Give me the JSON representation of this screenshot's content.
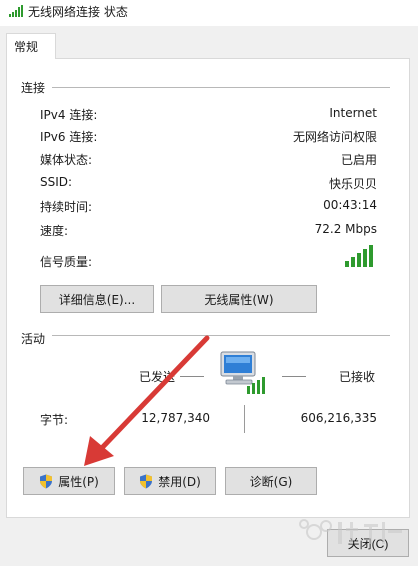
{
  "colors": {
    "panel_background": "#ffffff",
    "dialog_background": "#f0f0f0",
    "signal_green": "#2e9a2e",
    "arrow_red": "#d83a36"
  },
  "window": {
    "title": "无线网络连接 状态",
    "title_icon": "wifi-signal-icon"
  },
  "tabs": [
    {
      "label": "常规",
      "selected": true
    }
  ],
  "connection": {
    "group_title": "连接",
    "rows": [
      {
        "label": "IPv4 连接:",
        "value": "Internet"
      },
      {
        "label": "IPv6 连接:",
        "value": "无网络访问权限"
      },
      {
        "label": "媒体状态:",
        "value": "已启用"
      },
      {
        "label": "SSID:",
        "value": "快乐贝贝"
      },
      {
        "label": "持续时间:",
        "value": "00:43:14"
      },
      {
        "label": "速度:",
        "value": "72.2 Mbps"
      },
      {
        "label": "信号质量:",
        "value": ""
      }
    ],
    "signal_quality_icon": "signal-strength-icon",
    "signal_bars_filled": 5,
    "signal_bars_total": 5,
    "buttons": {
      "details": "详细信息(E)...",
      "wireless_properties": "无线属性(W)"
    }
  },
  "activity": {
    "group_title": "活动",
    "sent_label": "已发送",
    "received_label": "已接收",
    "bytes_label": "字节:",
    "bytes_sent": "12,787,340",
    "bytes_received": "606,216,335",
    "network_icon": "network-computer-icon"
  },
  "action_buttons": {
    "properties": "属性(P)",
    "disable": "禁用(D)",
    "diagnose": "诊断(G)",
    "shield_icon": "uac-shield-icon"
  },
  "close_label": "关闭(C)",
  "watermark": {
    "text": "Baidu 经验"
  }
}
